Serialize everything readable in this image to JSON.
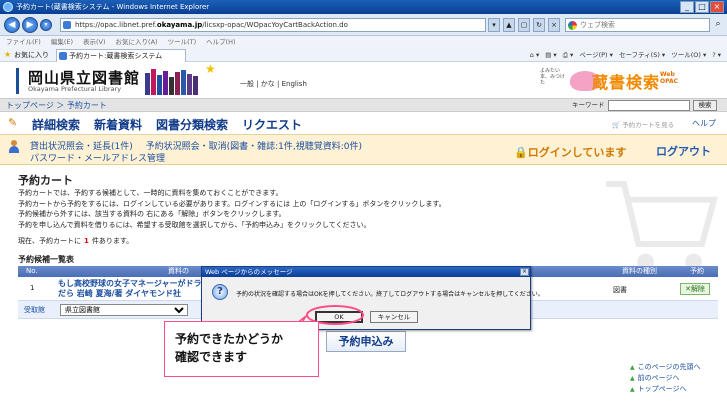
{
  "browser": {
    "title": "予約カート(蔵書検索システム - Windows Internet Explorer",
    "url_prefix": "https://opac.libnet.pref.",
    "url_domain": "okayama.jp",
    "url_suffix": "/licsxp-opac/WOpacYoyCartBackAction.do",
    "search_placeholder": "ウェブ検索",
    "menu": [
      "ファイル(F)",
      "編集(E)",
      "表示(V)",
      "お気に入り(A)",
      "ツール(T)",
      "ヘルプ(H)"
    ],
    "favorites_label": "お気に入り",
    "tab_label": "予約カート:蔵書検索システム",
    "toolbar_right": [
      "ページ(P) ▾",
      "セーフティ(S) ▾",
      "ツール(O) ▾"
    ]
  },
  "header": {
    "library_name": "岡山県立図書館",
    "library_name_en": "Okayama Prefectural Library",
    "languages": "一般 | かな | English",
    "tagline": "よみたい本、みつけた",
    "search_logo": "蔵書検索",
    "web_opac": "Web OPAC"
  },
  "crumbbar": {
    "breadcrumb": "トップページ ＞ 予約カート",
    "keyword_label": "キーワード",
    "search_button": "検索"
  },
  "mainnav": {
    "items": [
      "詳細検索",
      "新着資料",
      "図書分類検索",
      "リクエスト"
    ],
    "cart_link": "予約カートを見る",
    "help": "ヘルプ"
  },
  "subnav": {
    "links": [
      "貸出状況照会・延長(1件)",
      "予約状況照会・取消(図書・雑誌:1件,視聴覚資料:0件)"
    ],
    "password_link": "パスワード・メールアドレス管理",
    "login_status": "ログインしています",
    "logout": "ログアウト"
  },
  "main": {
    "title": "予約カート",
    "desc": [
      "予約カートでは、予約する候補として、一時的に資料を集めておくことができます。",
      "予約カートから予約をするには、ログインしている必要があります。ログインするには 上の「ログインする」ボタンをクリックします。",
      "予約候補から外すには、該当する資料の 右にある「解除」ボタンをクリックします。",
      "予約を申し込んで資料を借りるには、希望する受取館を選択してから、「予約申込み」をクリックしてください。"
    ],
    "count_prefix": "現在、予約カートに",
    "count_value": "1",
    "count_suffix": "件あります。",
    "list_title": "予約候補一覧表",
    "columns": {
      "no": "No.",
      "name": "資料の",
      "type": "資料の種別",
      "reserve": "予約"
    },
    "row": {
      "no": "1",
      "name": "もし高校野球の女子マネージャーがドラッカーの",
      "name2": "だら 岩崎 夏海/著 ダイヤモンド社",
      "type": "図書",
      "delete": "解除"
    },
    "branch_label": "受取館",
    "branch_value": "県立図書館",
    "apply_button": "予約申込み",
    "footer_links": [
      "このページの先頭へ",
      "前のページへ",
      "トップページへ"
    ]
  },
  "dialog": {
    "title": "Web ページからのメッセージ",
    "message": "予約の状況を確認する場合はOKを押してください。終了してログアウトする場合はキャンセルを押してください。",
    "ok": "OK",
    "cancel": "キャンセル"
  },
  "annotation": {
    "line1": "予約できたかどうか",
    "line2": "確認できます"
  },
  "colors": {
    "accent_blue": "#123c8a",
    "login_orange": "#d07800",
    "highlight_pink": "#ff4a8a"
  }
}
